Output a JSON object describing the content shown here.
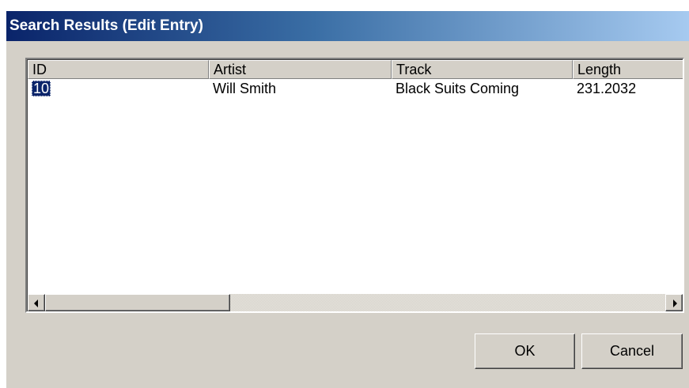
{
  "window": {
    "title": "Search Results (Edit Entry)"
  },
  "list": {
    "columns": [
      "ID",
      "Artist",
      "Track",
      "Length"
    ],
    "rows": [
      [
        "10",
        "Will Smith",
        "Black Suits Coming",
        "231.2032"
      ]
    ],
    "selected_row": 0
  },
  "buttons": {
    "ok_label": "OK",
    "cancel_label": "Cancel"
  },
  "colors": {
    "titlebar_start": "#0a246a",
    "titlebar_end": "#a6caf0",
    "face": "#d4d0c8",
    "selection": "#0a246a"
  },
  "icons": {
    "scroll_left": "scroll-left-arrow-icon",
    "scroll_right": "scroll-right-arrow-icon"
  }
}
